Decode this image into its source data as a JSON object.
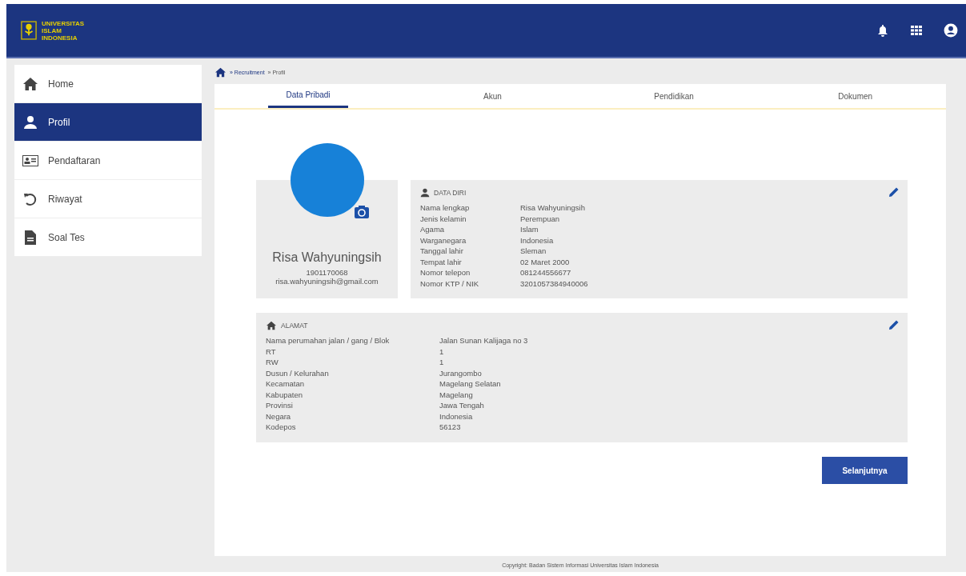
{
  "header": {
    "logo_text": [
      "UNIVERSITAS",
      "ISLAM",
      "INDONESIA"
    ]
  },
  "sidebar": {
    "items": [
      {
        "label": "Home",
        "kind": "home",
        "selected": false
      },
      {
        "label": "Profil",
        "kind": "user",
        "selected": true
      },
      {
        "label": "Pendaftaran",
        "kind": "card",
        "selected": false
      },
      {
        "label": "Riwayat",
        "kind": "history",
        "selected": false
      },
      {
        "label": "Soal Tes",
        "kind": "file",
        "selected": false
      }
    ]
  },
  "breadcrumb": [
    "» Recruitment",
    "» Profil"
  ],
  "tabs": [
    {
      "label": "Data Pribadi",
      "selected": true
    },
    {
      "label": "Akun",
      "selected": false
    },
    {
      "label": "Pendidikan",
      "selected": false
    },
    {
      "label": "Dokumen",
      "selected": false
    }
  ],
  "profile": {
    "name": "Risa Wahyuningsih",
    "id": "1901170068",
    "email": "risa.wahyuningsih@gmail.com"
  },
  "data_diri": {
    "title": "DATA DIRI",
    "rows": [
      {
        "label": "Nama lengkap",
        "value": "Risa Wahyuningsih"
      },
      {
        "label": "Jenis kelamin",
        "value": "Perempuan"
      },
      {
        "label": "Agama",
        "value": "Islam"
      },
      {
        "label": "Warganegara",
        "value": "Indonesia"
      },
      {
        "label": "Tanggal lahir",
        "value": "Sleman"
      },
      {
        "label": "Tempat lahir",
        "value": "02 Maret 2000"
      },
      {
        "label": "Nomor telepon",
        "value": "081244556677"
      },
      {
        "label": "Nomor KTP / NIK",
        "value": "3201057384940006"
      }
    ]
  },
  "alamat": {
    "title": "ALAMAT",
    "rows": [
      {
        "label": "Nama perumahan jalan / gang /  Blok",
        "value": "Jalan Sunan Kalijaga no 3"
      },
      {
        "label": "RT",
        "value": "1"
      },
      {
        "label": "RW",
        "value": "1"
      },
      {
        "label": "Dusun / Kelurahan",
        "value": "Jurangombo"
      },
      {
        "label": "Kecamatan",
        "value": "Magelang Selatan"
      },
      {
        "label": "Kabupaten",
        "value": "Magelang"
      },
      {
        "label": "Provinsi",
        "value": "Jawa Tengah"
      },
      {
        "label": "Negara",
        "value": "Indonesia"
      },
      {
        "label": "Kodepos",
        "value": "56123"
      }
    ]
  },
  "next_button": "Selanjutnya",
  "footer": "Copyright: Badan Sistem Informasi Universitas Islam Indonesia"
}
